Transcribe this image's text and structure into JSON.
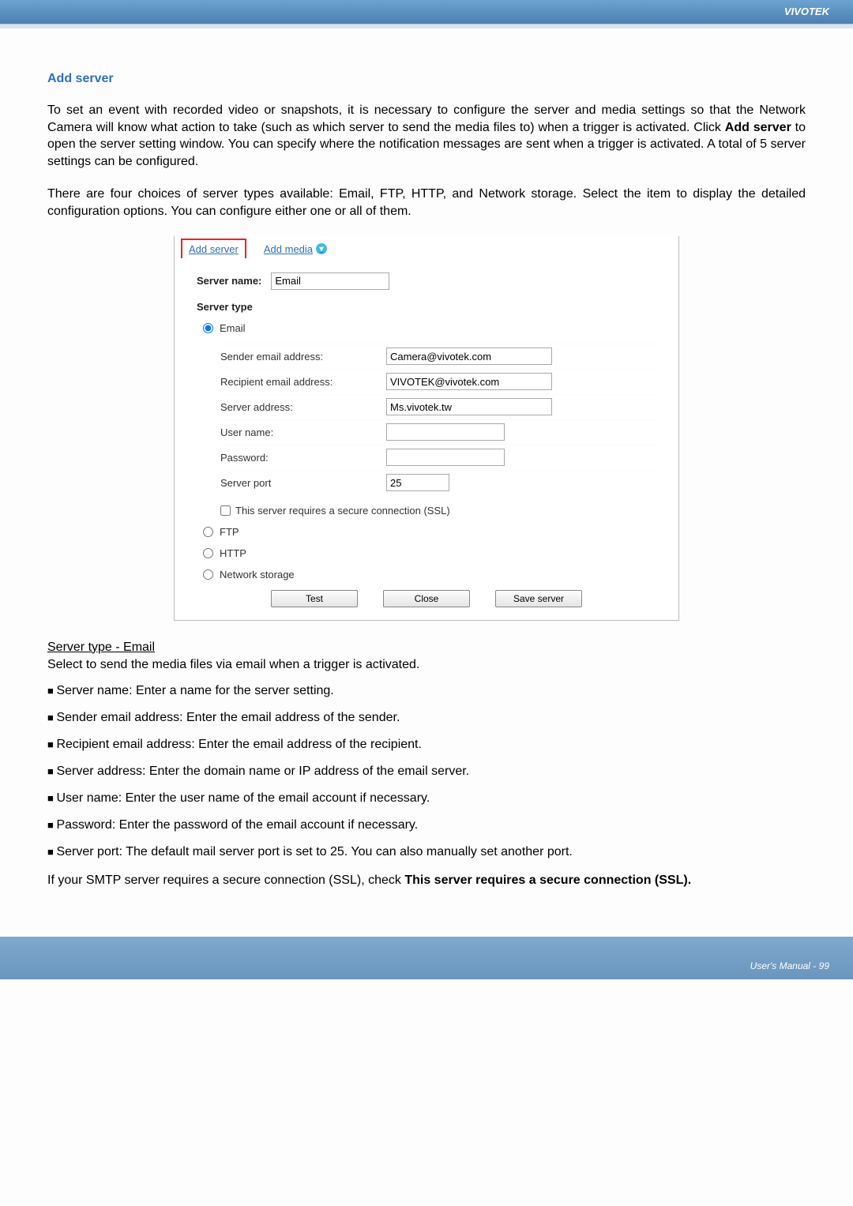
{
  "header": {
    "brand": "VIVOTEK"
  },
  "title": "Add server",
  "para1_a": "To set an event with recorded video or snapshots, it is necessary to configure the server and media settings so that the Network Camera will know what action to take (such as which server to send the media files to) when a trigger is activated. Click ",
  "para1_bold": "Add server",
  "para1_b": " to open the server setting window. You can specify where the notification messages are sent when a trigger is activated. A total of 5 server settings can be configured.",
  "para2": "There are four choices of server types available: Email, FTP, HTTP, and Network storage. Select the item to display the detailed configuration options. You can configure either one or all of them.",
  "dialog": {
    "tab_add_server": "Add server",
    "tab_add_media": "Add media",
    "server_name_label": "Server name:",
    "server_name_value": "Email",
    "server_type_label": "Server type",
    "radio_email": "Email",
    "fields": {
      "sender_label": "Sender email address:",
      "sender_value": "Camera@vivotek.com",
      "recipient_label": "Recipient email address:",
      "recipient_value": "VIVOTEK@vivotek.com",
      "server_addr_label": "Server address:",
      "server_addr_value": "Ms.vivotek.tw",
      "username_label": "User name:",
      "username_value": "",
      "password_label": "Password:",
      "password_value": "",
      "port_label": "Server port",
      "port_value": "25"
    },
    "ssl_label": "This server requires a secure connection (SSL)",
    "radio_ftp": "FTP",
    "radio_http": "HTTP",
    "radio_ns": "Network storage",
    "btn_test": "Test",
    "btn_close": "Close",
    "btn_save": "Save server"
  },
  "subhead": "Server type - Email",
  "subpara": "Select to send the media files via email when a trigger is activated.",
  "bullets": {
    "b1": "Server name: Enter a name for the server setting.",
    "b2": "Sender email address: Enter the email address of the sender.",
    "b3": "Recipient email address: Enter the email address of the recipient.",
    "b4": "Server address: Enter the domain name or IP address of the email server.",
    "b5": "User name: Enter the user name of the email account if necessary.",
    "b6": "Password: Enter the password of the email account if necessary.",
    "b7": "Server port: The default mail server port is set to 25. You can also manually set another port."
  },
  "closing_a": "If your SMTP server requires a secure connection (SSL), check ",
  "closing_b": "This server requires a secure connection (SSL).",
  "footer": "User's Manual - 99"
}
